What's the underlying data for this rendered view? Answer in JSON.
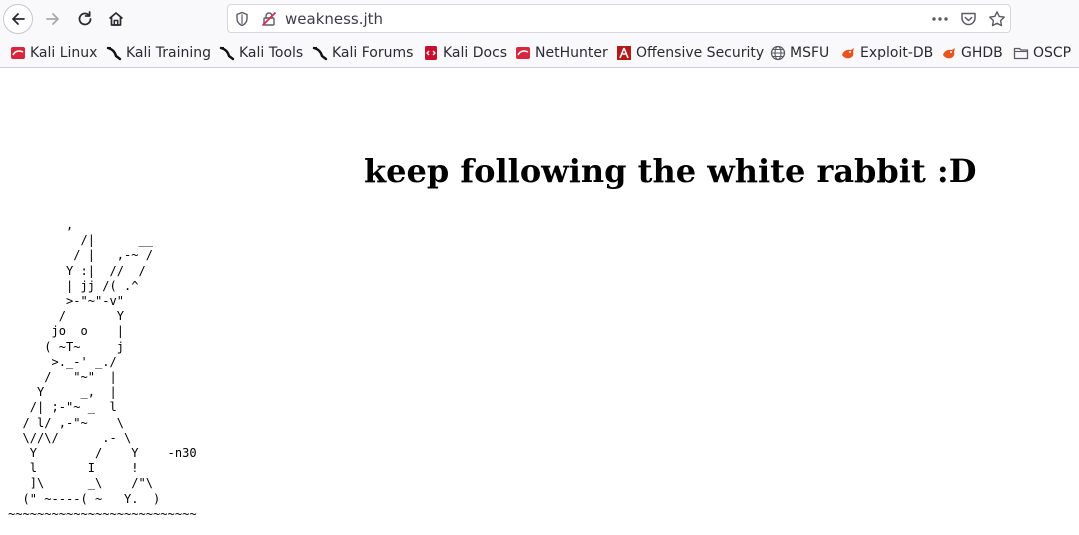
{
  "browser": {
    "url": "weakness.jth"
  },
  "bookmarks": [
    {
      "label": "Kali Linux",
      "icon": "kali-linux-icon"
    },
    {
      "label": "Kali Training",
      "icon": "kali-dragon-icon"
    },
    {
      "label": "Kali Tools",
      "icon": "kali-dragon-icon"
    },
    {
      "label": "Kali Forums",
      "icon": "kali-dragon-icon"
    },
    {
      "label": "Kali Docs",
      "icon": "kali-docs-icon"
    },
    {
      "label": "NetHunter",
      "icon": "nethunter-icon"
    },
    {
      "label": "Offensive Security",
      "icon": "offsec-icon"
    },
    {
      "label": "MSFU",
      "icon": "globe-icon"
    },
    {
      "label": "Exploit-DB",
      "icon": "exploit-db-icon"
    },
    {
      "label": "GHDB",
      "icon": "ghdb-icon"
    },
    {
      "label": "OSCP",
      "icon": "folder-icon"
    }
  ],
  "page": {
    "heading": "keep following the white rabbit :D",
    "ascii_art": "        ,\n          /|      __\n         / |   ,-~ /\n        Y :|  //  /\n        | jj /( .^\n        >-\"~\"-v\"\n       /       Y\n      jo  o    |\n     ( ~T~     j\n      >._-' _./\n     /   \"~\"  |\n    Y     _,  |\n   /| ;-\"~ _  l\n  / l/ ,-\"~    \\\n  \\//\\/      .- \\\n   Y        /    Y    -n30\n   l       I     !\n   ]\\      _\\    /\"\\\n  (\" ~----( ~   Y.  )\n~~~~~~~~~~~~~~~~~~~~~~~~~~"
  }
}
